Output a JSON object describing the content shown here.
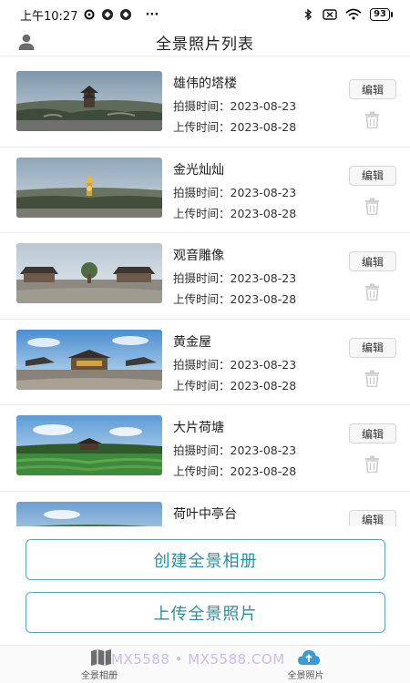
{
  "status_bar": {
    "time": "上午10:27",
    "more": "···",
    "battery": "93"
  },
  "header": {
    "title": "全景照片列表"
  },
  "photos": [
    {
      "title": "雄伟的塔楼",
      "shot": "拍摄时间：2023-08-23",
      "upload": "上传时间：2023-08-28",
      "edit": "编辑"
    },
    {
      "title": "金光灿灿",
      "shot": "拍摄时间：2023-08-23",
      "upload": "上传时间：2023-08-28",
      "edit": "编辑"
    },
    {
      "title": "观音雕像",
      "shot": "拍摄时间：2023-08-23",
      "upload": "上传时间：2023-08-28",
      "edit": "编辑"
    },
    {
      "title": "黄金屋",
      "shot": "拍摄时间：2023-08-23",
      "upload": "上传时间：2023-08-28",
      "edit": "编辑"
    },
    {
      "title": "大片荷塘",
      "shot": "拍摄时间：2023-08-23",
      "upload": "上传时间：2023-08-28",
      "edit": "编辑"
    },
    {
      "title": "荷叶中亭台",
      "shot": "",
      "upload": "",
      "edit": "编辑"
    }
  ],
  "actions": {
    "create_label": "创建全景相册",
    "upload_label": "上传全景照片"
  },
  "tabs": {
    "album_label": "全景相册",
    "photo_label": "全景照片"
  },
  "watermark": "MX5588 • MX5588.COM",
  "colors": {
    "accent": "#2e8e9a",
    "accent_border": "#58a7b0",
    "upload_icon": "#3a9ad6"
  }
}
